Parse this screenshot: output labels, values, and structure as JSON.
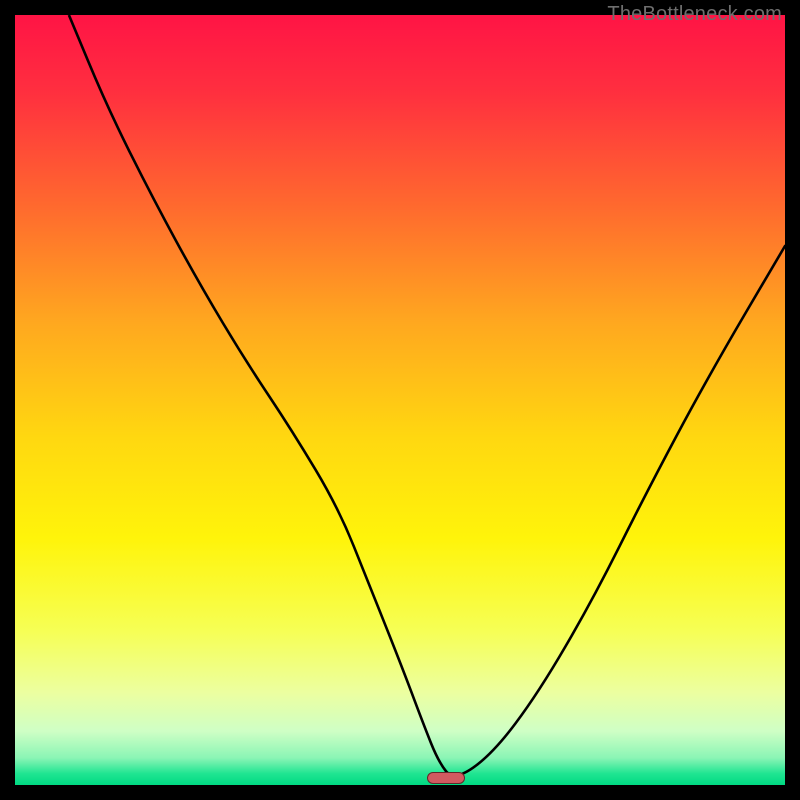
{
  "watermark": "TheBottleneck.com",
  "colors": {
    "frame": "#000000",
    "gradient_stops": [
      {
        "offset": 0.0,
        "color": "#ff1445"
      },
      {
        "offset": 0.1,
        "color": "#ff2f3f"
      },
      {
        "offset": 0.25,
        "color": "#ff6a2e"
      },
      {
        "offset": 0.4,
        "color": "#ffa81f"
      },
      {
        "offset": 0.55,
        "color": "#ffd810"
      },
      {
        "offset": 0.68,
        "color": "#fff40a"
      },
      {
        "offset": 0.8,
        "color": "#f6ff55"
      },
      {
        "offset": 0.88,
        "color": "#ecffa0"
      },
      {
        "offset": 0.93,
        "color": "#cfffc5"
      },
      {
        "offset": 0.965,
        "color": "#8af5b5"
      },
      {
        "offset": 0.985,
        "color": "#20e592"
      },
      {
        "offset": 1.0,
        "color": "#00da82"
      }
    ],
    "curve": "#000000",
    "marker_fill": "#d15a60",
    "marker_stroke": "rgba(0,0,0,0.55)"
  },
  "chart_data": {
    "type": "line",
    "title": "",
    "xlabel": "",
    "ylabel": "",
    "xlim": [
      0,
      100
    ],
    "ylim": [
      0,
      100
    ],
    "series": [
      {
        "name": "bottleneck-curve",
        "x": [
          7,
          12,
          18,
          24,
          30,
          36,
          42,
          46,
          50,
          53,
          55,
          57,
          62,
          68,
          75,
          82,
          90,
          100
        ],
        "y": [
          100,
          88,
          76,
          65,
          55,
          46,
          36,
          26,
          16,
          8,
          3,
          0.5,
          4,
          12,
          24,
          38,
          53,
          70
        ]
      }
    ],
    "marker": {
      "x_start": 53.5,
      "x_end": 58.5,
      "y": 0.9,
      "height": 1.6
    }
  }
}
